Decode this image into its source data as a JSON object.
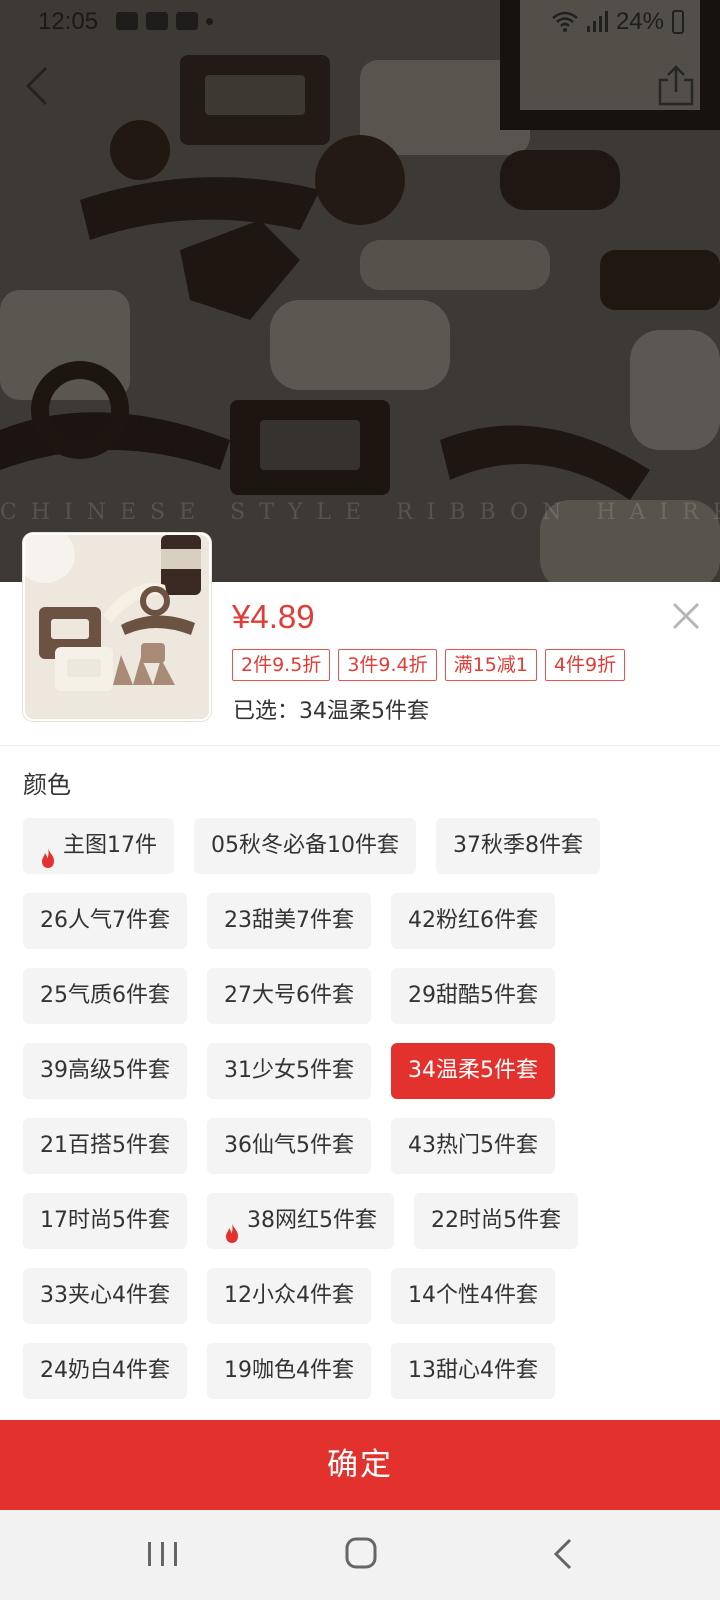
{
  "status_bar": {
    "time": "12:05",
    "battery": "24%",
    "notification_icons": [
      "image-icon",
      "zalo-icon",
      "zalo-icon"
    ]
  },
  "hero": {
    "watermark": "CHINESE STYLE RIBBON HAIRPIN"
  },
  "product": {
    "price": "¥4.89",
    "promotions": [
      "2件9.5折",
      "3件9.4折",
      "满15减1",
      "4件9折"
    ],
    "selected_label": "已选：",
    "selected_value": "34温柔5件套"
  },
  "color_section": {
    "title": "颜色",
    "options": [
      {
        "label": "主图17件",
        "hot": true,
        "selected": false
      },
      {
        "label": "05秋冬必备10件套",
        "hot": false,
        "selected": false
      },
      {
        "label": "37秋季8件套",
        "hot": false,
        "selected": false
      },
      {
        "label": "26人气7件套",
        "hot": false,
        "selected": false
      },
      {
        "label": "23甜美7件套",
        "hot": false,
        "selected": false
      },
      {
        "label": "42粉红6件套",
        "hot": false,
        "selected": false
      },
      {
        "label": "25气质6件套",
        "hot": false,
        "selected": false
      },
      {
        "label": "27大号6件套",
        "hot": false,
        "selected": false
      },
      {
        "label": "29甜酷5件套",
        "hot": false,
        "selected": false
      },
      {
        "label": "39高级5件套",
        "hot": false,
        "selected": false
      },
      {
        "label": "31少女5件套",
        "hot": false,
        "selected": false
      },
      {
        "label": "34温柔5件套",
        "hot": false,
        "selected": true
      },
      {
        "label": "21百搭5件套",
        "hot": false,
        "selected": false
      },
      {
        "label": "36仙气5件套",
        "hot": false,
        "selected": false
      },
      {
        "label": "43热门5件套",
        "hot": false,
        "selected": false
      },
      {
        "label": "17时尚5件套",
        "hot": false,
        "selected": false
      },
      {
        "label": "38网红5件套",
        "hot": true,
        "selected": false
      },
      {
        "label": "22时尚5件套",
        "hot": false,
        "selected": false
      },
      {
        "label": "33夹心4件套",
        "hot": false,
        "selected": false
      },
      {
        "label": "12小众4件套",
        "hot": false,
        "selected": false
      },
      {
        "label": "14个性4件套",
        "hot": false,
        "selected": false
      },
      {
        "label": "24奶白4件套",
        "hot": false,
        "selected": false
      },
      {
        "label": "19咖色4件套",
        "hot": false,
        "selected": false
      },
      {
        "label": "13甜心4件套",
        "hot": false,
        "selected": false
      }
    ]
  },
  "confirm_label": "确定",
  "colors": {
    "accent": "#e3312d",
    "price": "#e23c36",
    "chip_bg": "#f4f4f4"
  }
}
